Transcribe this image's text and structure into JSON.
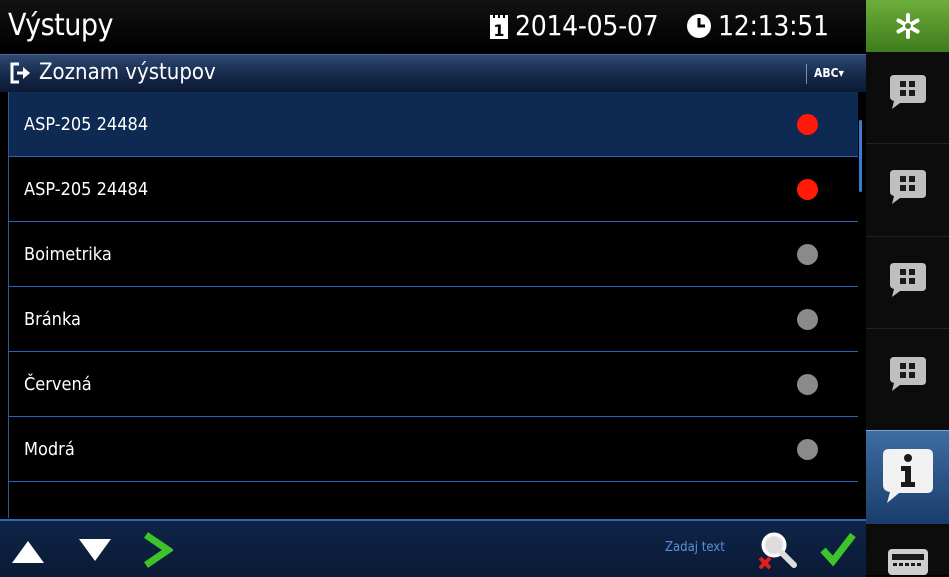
{
  "header": {
    "title": "Výstupy",
    "date": "2014-05-07",
    "time": "12:13:51",
    "calendar_icon_digit": "1"
  },
  "list_header": {
    "title": "Zoznam výstupov",
    "sort_label": "ABC▾"
  },
  "outputs": [
    {
      "name": "ASP-205 24484",
      "state_color": "#ff1a0a",
      "selected": true
    },
    {
      "name": "ASP-205 24484",
      "state_color": "#ff1a0a",
      "selected": false
    },
    {
      "name": "Boimetrika",
      "state_color": "#8a8a8a",
      "selected": false
    },
    {
      "name": "Bránka",
      "state_color": "#8a8a8a",
      "selected": false
    },
    {
      "name": "Červená",
      "state_color": "#8a8a8a",
      "selected": false
    },
    {
      "name": "Modrá",
      "state_color": "#8a8a8a",
      "selected": false
    }
  ],
  "toolbar": {
    "search_hint": "Zadaj text"
  },
  "colors": {
    "accent": "#2f67b8",
    "home_green": "#4e8e28",
    "active_red": "#ff1a0a",
    "inactive_gray": "#8a8a8a",
    "ok_green": "#3fc32a"
  },
  "icons": {
    "up": "arrow-up-icon",
    "down": "arrow-down-icon",
    "enter": "chevron-right-icon",
    "search": "search-clear-icon",
    "ok": "checkmark-icon"
  }
}
